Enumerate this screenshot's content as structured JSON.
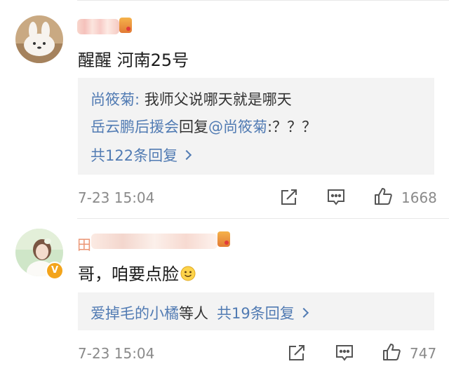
{
  "comments": [
    {
      "text": "醒醒 河南25号",
      "replies_box": {
        "line1": {
          "author": "尚筱菊",
          "separator": ": ",
          "text": "我师父说哪天就是哪天"
        },
        "line2": {
          "author": "岳云鹏后援会",
          "verb": "回复",
          "mention": "@尚筱菊",
          "text": ":？？？"
        },
        "more": "共122条回复"
      },
      "time": "7-23 15:04",
      "likes": "1668"
    },
    {
      "partial_name": "田",
      "text": "哥，咱要点脸",
      "replies_box": {
        "summary_user": "爱掉毛的小橘",
        "summary_suffix": "等人",
        "more": "共19条回复"
      },
      "time": "7-23 15:04",
      "likes": "747"
    }
  ],
  "icons": {
    "share": "share-icon",
    "comment": "comment-icon",
    "like": "thumbs-up-icon",
    "verified": "verified-v-icon"
  },
  "colors": {
    "link": "#517bb3",
    "badge": "#f3a41b"
  },
  "verified_badge_label": "V"
}
